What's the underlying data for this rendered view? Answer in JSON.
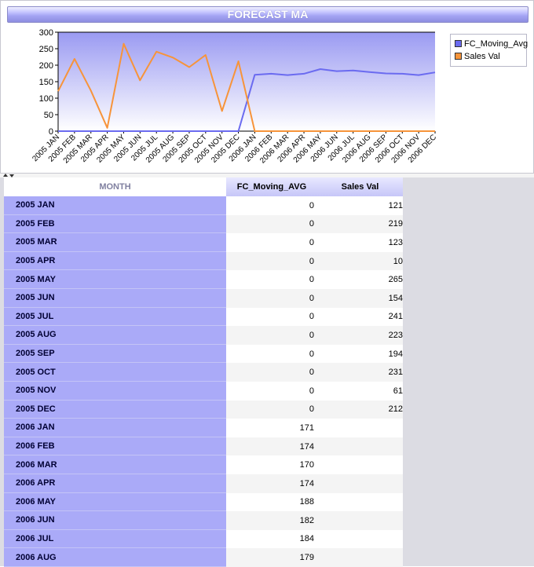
{
  "title": "FORECAST MA",
  "legend": {
    "fc_label": "FC_Moving_Avg",
    "sales_label": "Sales Val"
  },
  "colors": {
    "fc_series": "#6b6bf0",
    "sales_series": "#f7943a",
    "plot_top": "#9a9af2",
    "plot_bottom": "#ffffff",
    "month_cell": "#aaaaf8"
  },
  "grid": {
    "headers": {
      "month": "MONTH",
      "fc": "FC_Moving_AVG",
      "sales": "Sales Val"
    },
    "rows": [
      {
        "month": "2005 JAN",
        "fc": "0",
        "sales": "121"
      },
      {
        "month": "2005 FEB",
        "fc": "0",
        "sales": "219"
      },
      {
        "month": "2005 MAR",
        "fc": "0",
        "sales": "123"
      },
      {
        "month": "2005 APR",
        "fc": "0",
        "sales": "10"
      },
      {
        "month": "2005 MAY",
        "fc": "0",
        "sales": "265"
      },
      {
        "month": "2005 JUN",
        "fc": "0",
        "sales": "154"
      },
      {
        "month": "2005 JUL",
        "fc": "0",
        "sales": "241"
      },
      {
        "month": "2005 AUG",
        "fc": "0",
        "sales": "223"
      },
      {
        "month": "2005 SEP",
        "fc": "0",
        "sales": "194"
      },
      {
        "month": "2005 OCT",
        "fc": "0",
        "sales": "231"
      },
      {
        "month": "2005 NOV",
        "fc": "0",
        "sales": "61"
      },
      {
        "month": "2005 DEC",
        "fc": "0",
        "sales": "212"
      },
      {
        "month": "2006 JAN",
        "fc": "171",
        "sales": ""
      },
      {
        "month": "2006 FEB",
        "fc": "174",
        "sales": ""
      },
      {
        "month": "2006 MAR",
        "fc": "170",
        "sales": ""
      },
      {
        "month": "2006 APR",
        "fc": "174",
        "sales": ""
      },
      {
        "month": "2006 MAY",
        "fc": "188",
        "sales": ""
      },
      {
        "month": "2006 JUN",
        "fc": "182",
        "sales": ""
      },
      {
        "month": "2006 JUL",
        "fc": "184",
        "sales": ""
      },
      {
        "month": "2006 AUG",
        "fc": "179",
        "sales": ""
      }
    ]
  },
  "chart_data": {
    "type": "line",
    "title": "FORECAST MA",
    "categories": [
      "2005 JAN",
      "2005 FEB",
      "2005 MAR",
      "2005 APR",
      "2005 MAY",
      "2005 JUN",
      "2005 JUL",
      "2005 AUG",
      "2005 SEP",
      "2005 OCT",
      "2005 NOV",
      "2005 DEC",
      "2006 JAN",
      "2006 FEB",
      "2006 MAR",
      "2006 APR",
      "2006 MAY",
      "2006 JUN",
      "2006 JUL",
      "2006 AUG",
      "2006 SEP",
      "2006 OCT",
      "2006 NOV",
      "2006 DEC"
    ],
    "series": [
      {
        "name": "FC_Moving_Avg",
        "values": [
          0,
          0,
          0,
          0,
          0,
          0,
          0,
          0,
          0,
          0,
          0,
          0,
          171,
          174,
          170,
          174,
          188,
          182,
          184,
          179,
          175,
          174,
          170,
          178
        ]
      },
      {
        "name": "Sales Val",
        "values": [
          121,
          219,
          123,
          10,
          265,
          154,
          241,
          223,
          194,
          231,
          61,
          212,
          0,
          0,
          0,
          0,
          0,
          0,
          0,
          0,
          0,
          0,
          0,
          0
        ]
      }
    ],
    "yticks": [
      "0",
      "50",
      "100",
      "150",
      "200",
      "250",
      "300"
    ],
    "ylim": [
      0,
      300
    ],
    "xlabel": "",
    "ylabel": "",
    "legend_position": "right",
    "grid": false
  }
}
